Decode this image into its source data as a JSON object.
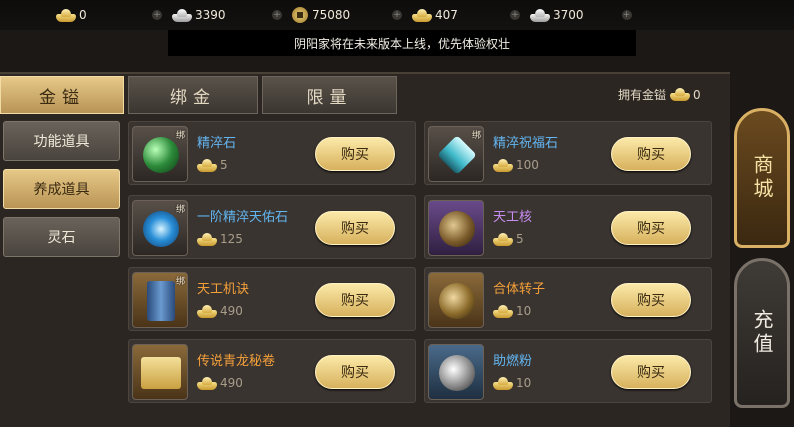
{
  "currencies": [
    {
      "name": "gold-ingot",
      "value": "0"
    },
    {
      "name": "silver-ingot",
      "value": "3390"
    },
    {
      "name": "copper-coin",
      "value": "75080"
    },
    {
      "name": "bound-gold-ingot",
      "value": "407"
    },
    {
      "name": "silver-ingot-2",
      "value": "3700"
    }
  ],
  "notice": "阴阳家将在未来版本上线，优先体验权壮",
  "tabs": [
    "金镒",
    "绑金",
    "限量"
  ],
  "owned": {
    "label": "拥有金镒",
    "value": "0"
  },
  "sidebar": [
    "功能道具",
    "养成道具",
    "灵石"
  ],
  "bound_tag": "绑",
  "buy_label": "购买",
  "items": [
    {
      "name": "精淬石",
      "price": "5",
      "quality": "blue",
      "bound": true
    },
    {
      "name": "精淬祝福石",
      "price": "100",
      "quality": "blue",
      "bound": true
    },
    {
      "name": "一阶精淬天佑石",
      "price": "125",
      "quality": "blue",
      "bound": true
    },
    {
      "name": "天工核",
      "price": "5",
      "quality": "purple",
      "bound": false
    },
    {
      "name": "天工机诀",
      "price": "490",
      "quality": "orange",
      "bound": true
    },
    {
      "name": "合体转子",
      "price": "10",
      "quality": "orange",
      "bound": false
    },
    {
      "name": "传说青龙秘卷",
      "price": "490",
      "quality": "orange",
      "bound": false
    },
    {
      "name": "助燃粉",
      "price": "10",
      "quality": "blue",
      "bound": false
    }
  ],
  "right_buttons": [
    "商城",
    "充值"
  ],
  "colors": {
    "blue": "#62b6f2",
    "purple": "#c78df2",
    "orange": "#f4a03a",
    "gold": "#e7c989"
  }
}
